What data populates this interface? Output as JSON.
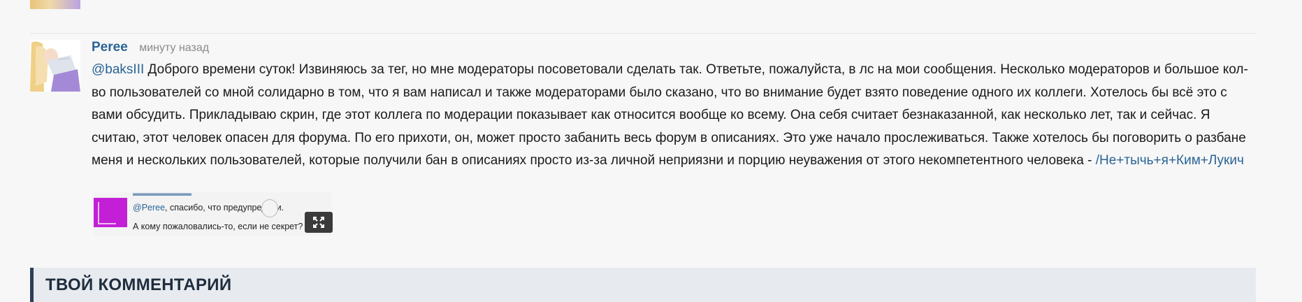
{
  "comment": {
    "author": "Peree",
    "time": "минуту назад",
    "mention": "@baksIII",
    "text": "Доброго времени суток! Извиняюсь за тег, но мне модераторы посоветовали сделать так. Ответьте, пожалуйста, в лс на мои сообщения. Несколько модераторов и большое кол-во пользователей со мной солидарно в том, что я вам написал и также модераторами было сказано, что во внимание будет взято поведение одного их коллеги. Хотелось бы всё это с вами обсудить. Прикладываю скрин, где этот коллега по модерации показывает как относится вообще ко всему. Она себя считает безнаказанной, как несколько лет, так и сейчас. Я считаю, этот человек опасен для форума. По его прихоти, он, может просто забанить весь форум в описаниях. Это уже начало прослеживаться. Также хотелось бы поговорить о разбане меня и нескольких пользователей, которые получили бан в описаниях просто из-за личной неприязни и порцию неуважения от этого некомпетентного человека - ",
    "link": "/Не+тычь+я+Ким+Лукич",
    "attachment": {
      "line1_mention": "@Peree",
      "line1_text": ", спасибо, что предупредили.",
      "line2": "А кому пожаловались-то, если не секрет?"
    }
  },
  "section": {
    "title": "ТВОЙ КОММЕНТАРИЙ"
  },
  "icons": {
    "expand": "expand-icon"
  },
  "colors": {
    "link": "#2a6496",
    "section_bg": "#e7eaef",
    "section_border": "#2c3e57"
  }
}
